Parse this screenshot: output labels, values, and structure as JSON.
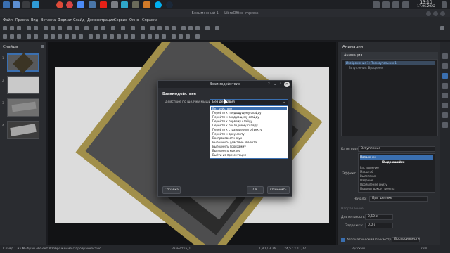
{
  "taskbar": {
    "clock_time": "13:10",
    "clock_date": "17.06.2022",
    "icons": [
      "app-menu-icon",
      "files-icon",
      "terminal-icon",
      "chrome-icon",
      "yandex-icon",
      "mail-icon",
      "telegram-icon",
      "vk-icon",
      "youtube-icon",
      "settings-icon",
      "music-icon",
      "gimp-icon",
      "impress-icon",
      "skype-icon",
      "steam-icon",
      "tray-icon"
    ]
  },
  "window": {
    "title": "Безымянный 1 — LibreOffice Impress"
  },
  "menubar": {
    "items": [
      "Файл",
      "Правка",
      "Вид",
      "Вставка",
      "Формат",
      "Слайд",
      "Демонстрация",
      "Сервис",
      "Окно",
      "Справка"
    ]
  },
  "slides_panel": {
    "header": "Слайды",
    "slide_numbers": [
      "1",
      "2",
      "3",
      "4"
    ]
  },
  "animation_panel": {
    "title": "Анимация",
    "subheader": "Анимация",
    "list": {
      "row1": "Изображение 1: Прямоугольник 1",
      "row2": "Вступление: Вращение"
    },
    "category_label": "Категория:",
    "category_value": "Вступление",
    "effect_label": "Эффект:",
    "effects": {
      "selected": "Появление",
      "header": "Выдающийся",
      "items": [
        "Растворение",
        "Масштаб",
        "Вылетание",
        "Падение",
        "Проявление снизу",
        "Поворот вокруг центра"
      ]
    },
    "start_label": "Начало:",
    "start_value": "При щелчке",
    "direction_label": "Направление:",
    "duration_label": "Длительность:",
    "duration_value": "0,50 с",
    "delay_label": "Задержка:",
    "delay_value": "0,0 с",
    "autopreview_label": "Автоматический просмотр",
    "play_label": "Воспроизвести"
  },
  "dialog": {
    "title": "Взаимодействие",
    "section": "Взаимодействие",
    "action_label": "Действие по щелчку мыши:",
    "action_value": "Без действия",
    "help_button": "Справка",
    "ok_button": "ОК",
    "cancel_button": "Отменить",
    "options": [
      "Без действия",
      "Перейти к предыдущему слайду",
      "Перейти к следующему слайду",
      "Перейти к первому слайду",
      "Перейти к последнему слайду",
      "Перейти к странице или объекту",
      "Перейти к документу",
      "Воспроизвести звук",
      "Выполнить действие объекта",
      "Выполнить программу",
      "Выполнить макрос",
      "Выйти из презентации"
    ]
  },
  "statusbar": {
    "slide_info": "Слайд 1 из 4",
    "selection_info": "Выбран объект Изображение с прозрачностью",
    "layout": "Разметка_1",
    "position": "1,80 / 3,26",
    "size": "24,57 x 11,77",
    "language": "Русский",
    "zoom": "73%"
  }
}
